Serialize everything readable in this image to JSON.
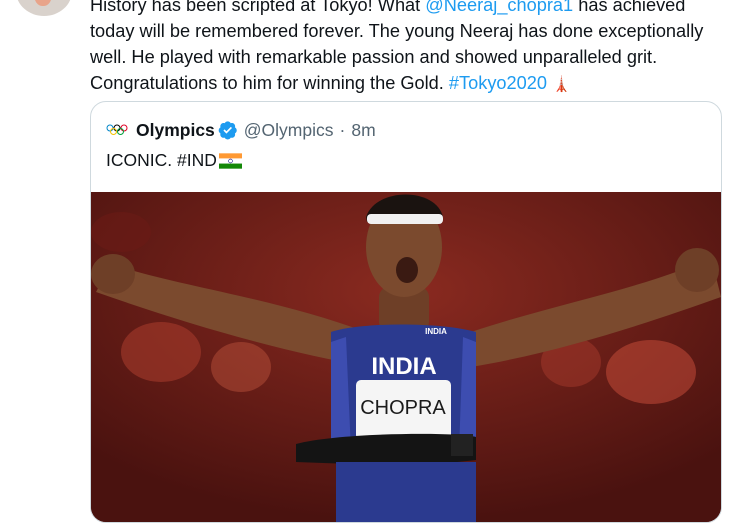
{
  "tweet": {
    "text_line1_before": "History has been scripted at Tokyo! What ",
    "mention": "@Neeraj_chopra1",
    "text_line1_after": " has achieved",
    "text_line2": "today will be remembered forever. The young Neeraj has done exceptionally",
    "text_line3": "well. He played with remarkable passion and showed unparalleled grit.",
    "text_line4": "Congratulations to him for winning the Gold. ",
    "hashtag": "#Tokyo2020",
    "emoji_icon": "tokyo-tower-icon"
  },
  "quoted": {
    "name": "Olympics",
    "handle": "@Olympics",
    "separator": "·",
    "time": "8m",
    "text": "ICONIC. #IND",
    "avatar_icon": "olympic-rings-icon",
    "verified_icon": "verified-badge-icon",
    "flag_icon": "india-flag-icon"
  },
  "photo": {
    "bib_text": "CHOPRA",
    "vest_text": "INDIA",
    "chest_label": "INDIA"
  },
  "colors": {
    "link": "#1d9bf0",
    "text": "#0f1419",
    "secondary": "#536471",
    "border": "#cfd9de"
  }
}
